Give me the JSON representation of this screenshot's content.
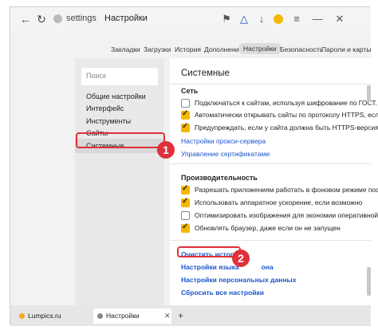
{
  "browser": {
    "address_host": "settings",
    "address_page": "Настройки",
    "icons": {
      "back": "arrow-left-icon",
      "refresh": "refresh-icon",
      "bookmark": "bookmark-icon",
      "alice": "voice-assistant-icon",
      "downloads": "download-icon",
      "menu": "menu-icon",
      "minimize": "minimize-icon",
      "close": "close-icon"
    },
    "glyphs": {
      "back": "←",
      "refresh": "↻",
      "bookmark": "⚑",
      "alice": "△",
      "downloads": "↓",
      "menu": "≡",
      "minimize": "—",
      "close": "✕"
    }
  },
  "settings_tabs": [
    "Закладки",
    "Загрузки",
    "История",
    "Дополнения",
    "Настройки",
    "Безопасность",
    "Пароли и карты"
  ],
  "active_tab_index": 4,
  "sidebar": {
    "search_placeholder": "Поиск",
    "items": [
      "Общие настройки",
      "Интерфейс",
      "Инструменты",
      "Сайты",
      "Системные"
    ],
    "selected_index": 4
  },
  "content": {
    "title": "Системные",
    "network": {
      "heading": "Сеть",
      "options": [
        {
          "label": "Подключаться к сайтам, используя шифрование по ГОСТ.",
          "checked": false
        },
        {
          "label": "Автоматически открывать сайты по протоколу HTTPS, если он",
          "checked": true
        },
        {
          "label": "Предупреждать, если у сайта должна быть HTTPS-версия, но",
          "checked": true
        }
      ],
      "links": [
        "Настройки прокси-сервера",
        "Управление сертификатами"
      ]
    },
    "performance": {
      "heading": "Производительность",
      "options": [
        {
          "label": "Разрешать приложениям работать в фоновом режиме после з",
          "checked": true
        },
        {
          "label": "Использовать аппаратное ускорение, если возможно",
          "checked": true
        },
        {
          "label": "Оптимизировать изображения для экономии оперативной пам",
          "checked": false
        },
        {
          "label": "Обновлять браузер, даже если он не запущен",
          "checked": true
        }
      ]
    },
    "bottom_links": [
      "Очистить историю",
      "Настройки языка и региона",
      "Настройки персональных данных",
      "Сбросить все настройки"
    ],
    "language_link_visible": "Настройки языка",
    "language_link_tail": "она"
  },
  "badges": [
    "1",
    "2"
  ],
  "tabs_bottom": [
    {
      "label": "Lumpics.ru",
      "color": "#f5a623"
    },
    {
      "label": "Настройки",
      "color": "#888888"
    }
  ],
  "tab_glyphs": {
    "close": "✕",
    "new": "+"
  },
  "colors": {
    "accent_red": "#e0303a",
    "checkbox_yellow": "#f5b800",
    "link_blue": "#1a55c9"
  }
}
